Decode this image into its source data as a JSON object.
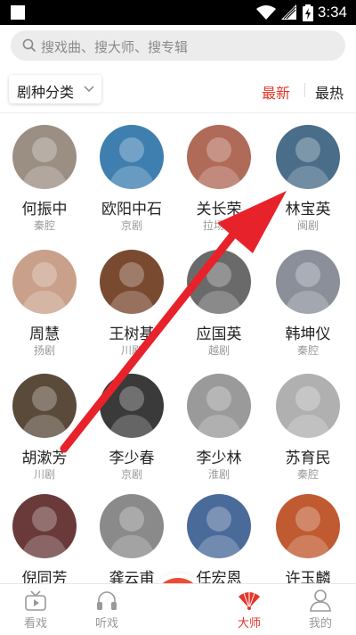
{
  "statusbar": {
    "time": "3:34"
  },
  "search": {
    "placeholder": "搜戏曲、搜大师、搜专辑"
  },
  "filter": {
    "category_label": "剧种分类",
    "sort_options": [
      "最新",
      "最热"
    ],
    "active_sort": "最新"
  },
  "masters": [
    {
      "name": "何振中",
      "opera": "秦腔",
      "icon": "portrait-photo",
      "bg": "#9b8f84"
    },
    {
      "name": "欧阳中石",
      "opera": "京剧",
      "icon": "portrait-photo",
      "bg": "#3e7fb0"
    },
    {
      "name": "关长荣",
      "opera": "拉场戏",
      "icon": "portrait-photo",
      "bg": "#b06a58"
    },
    {
      "name": "林宝英",
      "opera": "闽剧",
      "icon": "portrait-photo",
      "bg": "#4a6e8a"
    },
    {
      "name": "周慧",
      "opera": "扬剧",
      "icon": "portrait-photo",
      "bg": "#c9a08a"
    },
    {
      "name": "王树基",
      "opera": "川剧",
      "icon": "portrait-photo",
      "bg": "#7a4a30"
    },
    {
      "name": "应国英",
      "opera": "越剧",
      "icon": "portrait-photo",
      "bg": "#6a6a6a"
    },
    {
      "name": "韩坤仪",
      "opera": "秦腔",
      "icon": "portrait-photo",
      "bg": "#8a8f9a"
    },
    {
      "name": "胡漱芳",
      "opera": "川剧",
      "icon": "portrait-photo",
      "bg": "#5a4a3a"
    },
    {
      "name": "李少春",
      "opera": "京剧",
      "icon": "portrait-photo",
      "bg": "#3a3a3a"
    },
    {
      "name": "李少林",
      "opera": "淮剧",
      "icon": "portrait-photo",
      "bg": "#9a9a9a"
    },
    {
      "name": "苏育民",
      "opera": "秦腔",
      "icon": "portrait-photo",
      "bg": "#b0b0b0"
    },
    {
      "name": "倪同芳",
      "opera": "",
      "icon": "portrait-photo",
      "bg": "#6a3a3a"
    },
    {
      "name": "龚云甫",
      "opera": "",
      "icon": "portrait-photo",
      "bg": "#8a8a8a"
    },
    {
      "name": "任宏恩",
      "opera": "",
      "icon": "portrait-photo",
      "bg": "#4a6a9a"
    },
    {
      "name": "许玉麟",
      "opera": "",
      "icon": "portrait-photo",
      "bg": "#c05a30"
    }
  ],
  "tabs": [
    {
      "label": "看戏",
      "icon": "tv-icon"
    },
    {
      "label": "听戏",
      "icon": "headphones-icon"
    },
    {
      "label": "",
      "icon": "soundwave-icon"
    },
    {
      "label": "大师",
      "icon": "fan-icon"
    },
    {
      "label": "我的",
      "icon": "user-icon"
    }
  ],
  "active_tab": "大师",
  "colors": {
    "accent": "#e5352a",
    "annotation_arrow": "#e8222a"
  }
}
